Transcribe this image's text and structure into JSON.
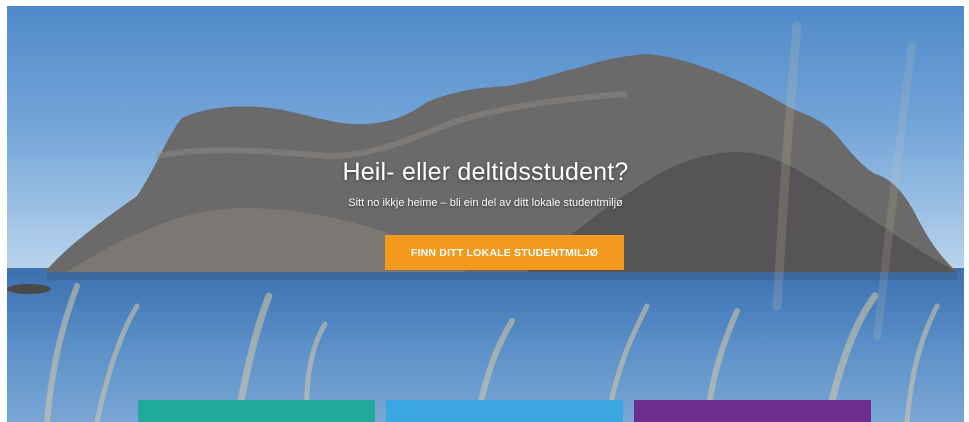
{
  "hero": {
    "title": "Heil- eller deltidsstudent?",
    "subtitle": "Sitt no ikkje heime – bli ein del av ditt lokale studentmiljø",
    "cta_label": "FINN DITT LOKALE STUDENTMILJØ"
  },
  "tiles": [
    {
      "label": "",
      "color": "#1faa9c"
    },
    {
      "label": "",
      "color": "#3aa7e2"
    },
    {
      "label": "",
      "color": "#6c2d8c"
    }
  ],
  "colors": {
    "cta": "#f39a1e",
    "sky": "#74a5d8",
    "sea": "#4a7fbd"
  }
}
